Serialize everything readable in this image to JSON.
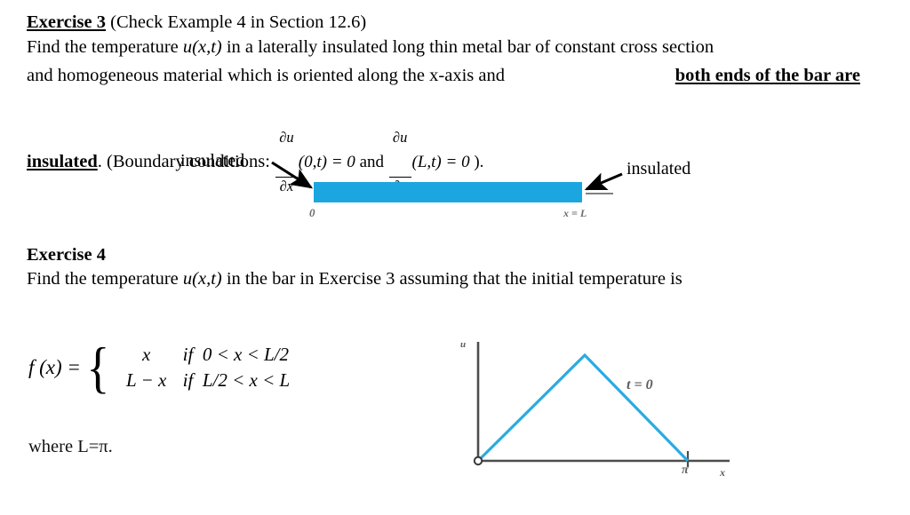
{
  "document": {
    "exercise3": {
      "heading": "Exercise 3",
      "heading_note": "(Check Example 4 in Section 12.6)",
      "line1_a": "Find the temperature ",
      "line1_b": "u(x,t)",
      "line1_c": " in a laterally insulated long thin metal bar of constant cross section",
      "line2_a": "and homogeneous material which is oriented along the x-axis and ",
      "line2_b": "both ends of the bar are",
      "line3_a": "insulated",
      "line3_b": ". (Boundary conditions: ",
      "bc_frac1_num": "∂u",
      "bc_frac1_den": "∂x",
      "bc1_args": "(0,t) = 0",
      "bc_and": " and ",
      "bc_frac2_num": "∂u",
      "bc_frac2_den": "∂x",
      "bc2_args": "(L,t) = 0",
      "bc_close": " )."
    },
    "bar_diagram": {
      "left_label": "insulated",
      "right_label": "insulated",
      "origin_label": "0",
      "end_label": "x = L",
      "bar_color": "#1CA6E0",
      "arrow_color": "#000000"
    },
    "exercise4": {
      "heading": "Exercise 4",
      "line1_a": "Find the temperature ",
      "line1_b": "u(x,t)",
      "line1_c": " in the bar in Exercise 3 assuming that the initial temperature is",
      "piecewise": {
        "lhs": "f (x) =",
        "rows": [
          {
            "value": "x",
            "condition": "if  0 < x < L/2"
          },
          {
            "value": "L − x",
            "condition": "if  L/2 < x < L"
          }
        ]
      },
      "where_note": "where L=π."
    }
  },
  "chart_data": {
    "type": "line",
    "title": "",
    "xlabel": "x",
    "ylabel": "u",
    "annotation": "t = 0",
    "x_tick_labels": [
      "π"
    ],
    "x": [
      0,
      1.5708,
      3.1416
    ],
    "y": [
      0,
      1.5708,
      0
    ],
    "xlim": [
      0,
      4.3
    ],
    "ylim": [
      0,
      1.95
    ],
    "grid": false,
    "legend": false,
    "series_color": "#29ABE2",
    "axis_color": "#4d4d4d",
    "origin_marker": true
  }
}
